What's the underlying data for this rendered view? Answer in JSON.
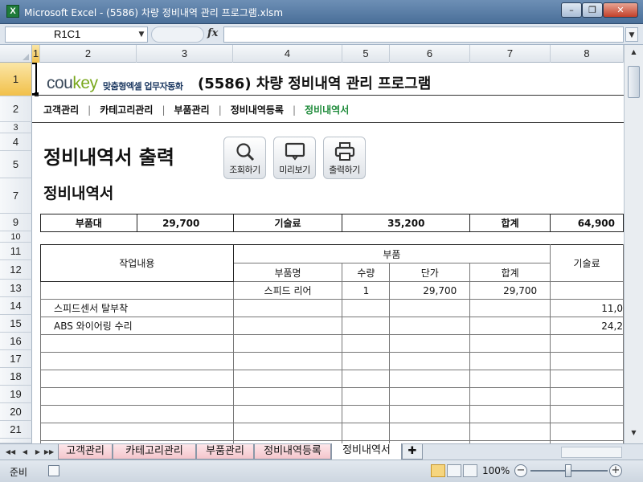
{
  "window": {
    "title": "Microsoft Excel - (5586) 차량 정비내역 관리 프로그램.xlsm",
    "app_letter": "X"
  },
  "formula_bar": {
    "name_box": "R1C1",
    "fx": "fx",
    "formula": ""
  },
  "columns": [
    "1",
    "2",
    "3",
    "4",
    "5",
    "6",
    "7",
    "8"
  ],
  "rows": [
    "1",
    "2",
    "3",
    "4",
    "5",
    "7",
    "9",
    "10",
    "11",
    "12",
    "13",
    "14",
    "15",
    "16",
    "17",
    "18",
    "19",
    "20",
    "21"
  ],
  "header": {
    "logo_main": "cou",
    "logo_key": "key",
    "logo_sub": "맞춤형엑셀 업무자동화",
    "program_title": "(5586) 차량 정비내역 관리 프로그램"
  },
  "nav": {
    "items": [
      "고객관리",
      "카테고리관리",
      "부품관리",
      "정비내역등록",
      "정비내역서"
    ],
    "separator": "|",
    "active_color": "#1e8b3a"
  },
  "page": {
    "title": "정비내역서 출력",
    "subtitle": "정비내역서",
    "buttons": [
      {
        "label": "조회하기",
        "icon": "magnifier-icon"
      },
      {
        "label": "미리보기",
        "icon": "monitor-icon"
      },
      {
        "label": "출력하기",
        "icon": "printer-icon"
      }
    ]
  },
  "summary": {
    "parts_label": "부품대",
    "parts_value": "29,700",
    "labor_label": "기술료",
    "labor_value": "35,200",
    "total_label": "합계",
    "total_value": "64,900"
  },
  "detail": {
    "headers": {
      "work": "작업내용",
      "parts": "부품",
      "part_name": "부품명",
      "qty": "수량",
      "unit_price": "단가",
      "sum": "합계",
      "labor": "기술료"
    },
    "rows": [
      {
        "work": "",
        "part_name": "스피드 리어",
        "qty": "1",
        "unit_price": "29,700",
        "sum": "29,700",
        "labor": ""
      },
      {
        "work": "스피드센서 탈부착",
        "part_name": "",
        "qty": "",
        "unit_price": "",
        "sum": "",
        "labor": "11,0"
      },
      {
        "work": "ABS 와이어링 수리",
        "part_name": "",
        "qty": "",
        "unit_price": "",
        "sum": "",
        "labor": "24,2"
      }
    ]
  },
  "sheet_tabs": [
    "고객관리",
    "카테고리관리",
    "부품관리",
    "정비내역등록",
    "정비내역서"
  ],
  "active_tab": "정비내역서",
  "status": {
    "ready": "준비",
    "zoom": "100%"
  }
}
